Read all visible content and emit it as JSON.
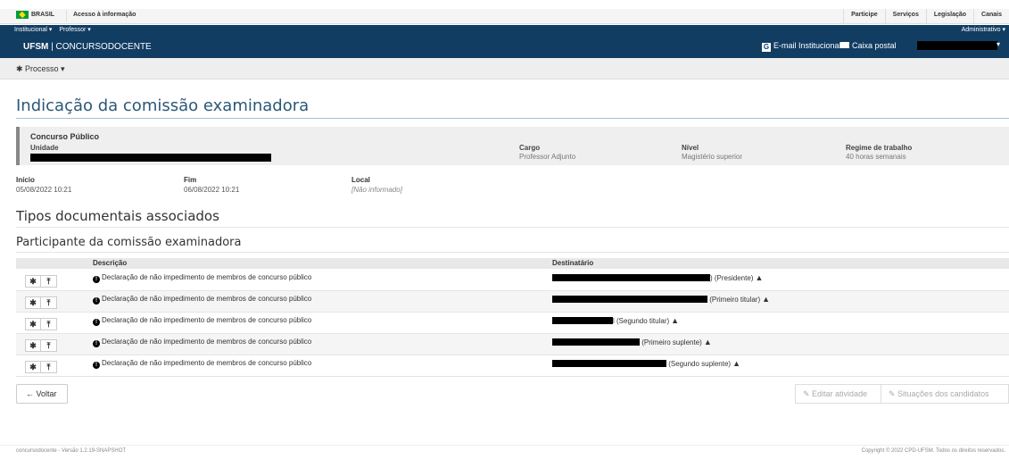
{
  "gov_bar": {
    "brasil": "BRASIL",
    "acesso": "Acesso à informação",
    "links": [
      "Participe",
      "Serviços",
      "Legislação",
      "Canais"
    ]
  },
  "system_bar": {
    "menu_institucional": "Institucional ▾",
    "menu_professor": "Professor ▾",
    "admin": "Administrativo ▾",
    "brand_bold": "UFSM",
    "brand_sep": " | ",
    "brand_name": "CONCURSODOCENTE",
    "email": "E-mail Institucional",
    "caixa": "Caixa postal",
    "caret": "▾"
  },
  "process_bar": {
    "label": "✱ Processo ▾"
  },
  "page_title": "Indicação da comissão examinadora",
  "panel": {
    "concurso": "Concurso Público",
    "unidade_label": "Unidade",
    "cargo_label": "Cargo",
    "cargo_value": "Professor Adjunto",
    "nivel_label": "Nível",
    "nivel_value": "Magistério superior",
    "regime_label": "Regime de trabalho",
    "regime_value": "40 horas semanais"
  },
  "dates": {
    "inicio_label": "Início",
    "inicio_value": "05/08/2022 10:21",
    "fim_label": "Fim",
    "fim_value": "06/08/2022 10:21",
    "local_label": "Local",
    "local_value": "[Não informado]"
  },
  "section_tipos": "Tipos documentais associados",
  "section_participante": "Participante da comissão examinadora",
  "table": {
    "col_descricao": "Descrição",
    "col_destinatario": "Destinatário",
    "rows": [
      {
        "descricao": "Declaração de não impedimento de membros de concurso público",
        "role": ") (Presidente)"
      },
      {
        "descricao": "Declaração de não impedimento de membros de concurso público",
        "role": " (Primeiro titular)"
      },
      {
        "descricao": "Declaração de não impedimento de membros de concurso público",
        "role": "l (Segundo titular)"
      },
      {
        "descricao": "Declaração de não impedimento de membros de concurso público",
        "role": " (Primeiro suplente)"
      },
      {
        "descricao": "Declaração de não impedimento de membros de concurso público",
        "role": " (Segundo suplente)"
      }
    ]
  },
  "buttons": {
    "voltar": "← Voltar",
    "editar": "✎ Editar atividade",
    "situacoes": "✎ Situações dos candidatos"
  },
  "footer": {
    "version": "concursodocente - Versão 1.2.19-SNAPSHOT",
    "copyright": "Copyright © 2022 CPD-UFSM. Todos os direitos reservados."
  }
}
